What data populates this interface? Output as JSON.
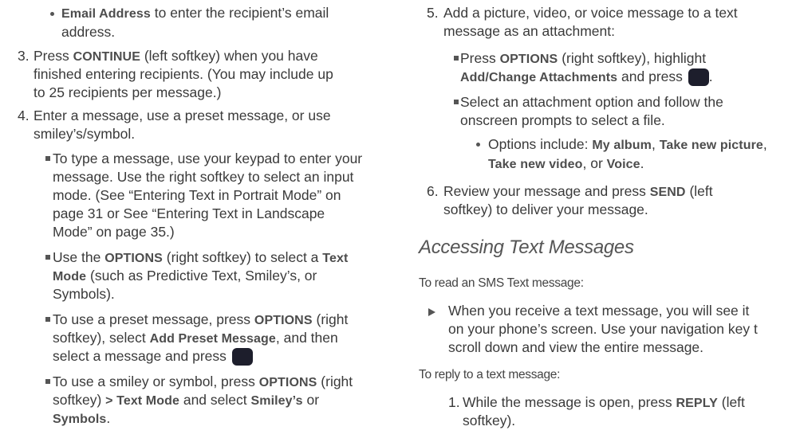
{
  "left": {
    "bullet_email": {
      "bold": "Email Address",
      "rest": " to enter the recipient’s email",
      "line2": "address."
    },
    "step3": {
      "num": "3.",
      "pre": "Press ",
      "bold": "CONTINUE",
      "rest": " (left softkey) when you have",
      "line2": "finished entering recipients. (You may include up",
      "line3": "to 25 recipients per message.)"
    },
    "step4": {
      "num": "4.",
      "line1": "Enter a message, use a preset message, or use",
      "line2": "smiley’s/symbol."
    },
    "sub_type": {
      "l1": "To type a message, use your keypad to enter your",
      "l2": "message. Use the right softkey to select an input",
      "l3": "mode. (See “Entering Text in Portrait Mode” on",
      "l4": "page 31 or See “Entering Text in Landscape",
      "l5": "Mode” on page 35.)"
    },
    "sub_options": {
      "pre": "Use the ",
      "bold1": "OPTIONS",
      "mid": " (right softkey) to select a ",
      "bold2": "Text",
      "bold3": "Mode",
      "rest": " (such as Predictive Text, Smiley’s, or",
      "l3": "Symbols)."
    },
    "sub_preset": {
      "pre": "To use a preset message, press ",
      "bold1": "OPTIONS",
      "mid": " (right",
      "l2pre": "softkey), select ",
      "bold2": "Add Preset Message",
      "l2rest": ", and then",
      "l3": "select a message and press "
    },
    "sub_smiley": {
      "pre": "To use a smiley or symbol, press ",
      "bold1": "OPTIONS",
      "mid": " (right",
      "l2pre": "softkey) ",
      "bold2": "> Text Mode",
      "l2mid": " and select ",
      "bold3": "Smiley’s",
      "l2rest": " or",
      "bold4": "Symbols",
      "l3rest": "."
    }
  },
  "right": {
    "step5": {
      "num": "5.",
      "l1": "Add a picture, video, or voice message to a text",
      "l2": "message as an attachment:"
    },
    "sub_attach": {
      "pre": "Press ",
      "bold1": "OPTIONS",
      "mid": " (right softkey), highlight",
      "bold2": "Add/Change Attachments",
      "rest": " and press "
    },
    "sub_select": {
      "l1": "Select an attachment option and follow the",
      "l2": "onscreen prompts to select a file."
    },
    "sub_opts": {
      "pre": "Options include: ",
      "b1": "My album",
      "sep1": ", ",
      "b2": "Take new picture",
      "sep2": ",",
      "b3": "Take new video",
      "sep3": ", or ",
      "b4": "Voice",
      "end": "."
    },
    "step6": {
      "num": "6.",
      "pre": "Review your message and press ",
      "bold": "SEND",
      "rest": " (left",
      "l2": "softkey) to deliver your message."
    },
    "heading": "Accessing Text Messages",
    "read_intro": "To read an SMS Text message:",
    "read_item": {
      "l1": "When you receive a text message, you will see it",
      "l2": "on your phone’s screen. Use your navigation key t",
      "l3": "scroll down and view the entire message."
    },
    "reply_intro": "To reply to a text message:",
    "step1": {
      "num": "1.",
      "pre": "While the message is open, press ",
      "bold": "REPLY",
      "rest": " (left",
      "l2": "softkey)."
    }
  }
}
